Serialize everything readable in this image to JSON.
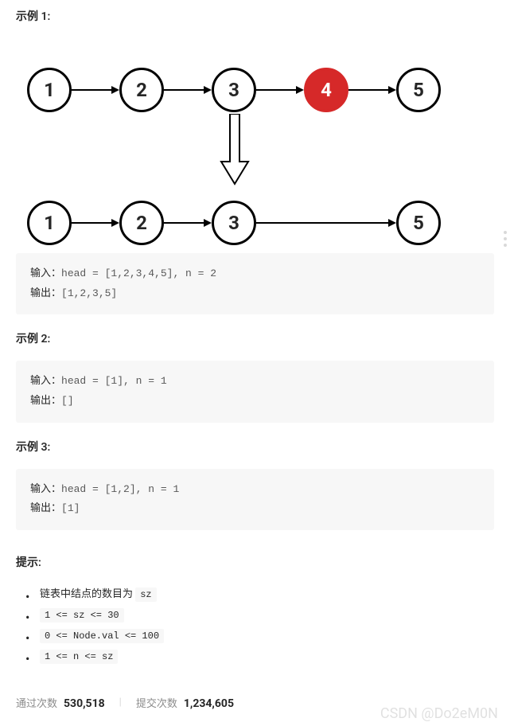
{
  "example1": {
    "title": "示例 1:",
    "nodes_top": [
      "1",
      "2",
      "3",
      "4",
      "5"
    ],
    "nodes_bottom": [
      "1",
      "2",
      "3",
      "5"
    ],
    "highlighted": "4",
    "input_label": "输入：",
    "input_value": "head = [1,2,3,4,5], n = 2",
    "output_label": "输出：",
    "output_value": "[1,2,3,5]"
  },
  "example2": {
    "title": "示例 2:",
    "input_label": "输入：",
    "input_value": "head = [1], n = 1",
    "output_label": "输出：",
    "output_value": "[]"
  },
  "example3": {
    "title": "示例 3:",
    "input_label": "输入：",
    "input_value": "head = [1,2], n = 1",
    "output_label": "输出：",
    "output_value": "[1]"
  },
  "hints": {
    "title": "提示:",
    "items": [
      {
        "prefix": "链表中结点的数目为 ",
        "code": "sz"
      },
      {
        "prefix": "",
        "code": "1 <= sz <= 30"
      },
      {
        "prefix": "",
        "code": "0 <= Node.val <= 100"
      },
      {
        "prefix": "",
        "code": "1 <= n <= sz"
      }
    ]
  },
  "stats": {
    "pass_label": "通过次数",
    "pass_value": "530,518",
    "submit_label": "提交次数",
    "submit_value": "1,234,605"
  },
  "watermark": "CSDN @Do2eM0N"
}
